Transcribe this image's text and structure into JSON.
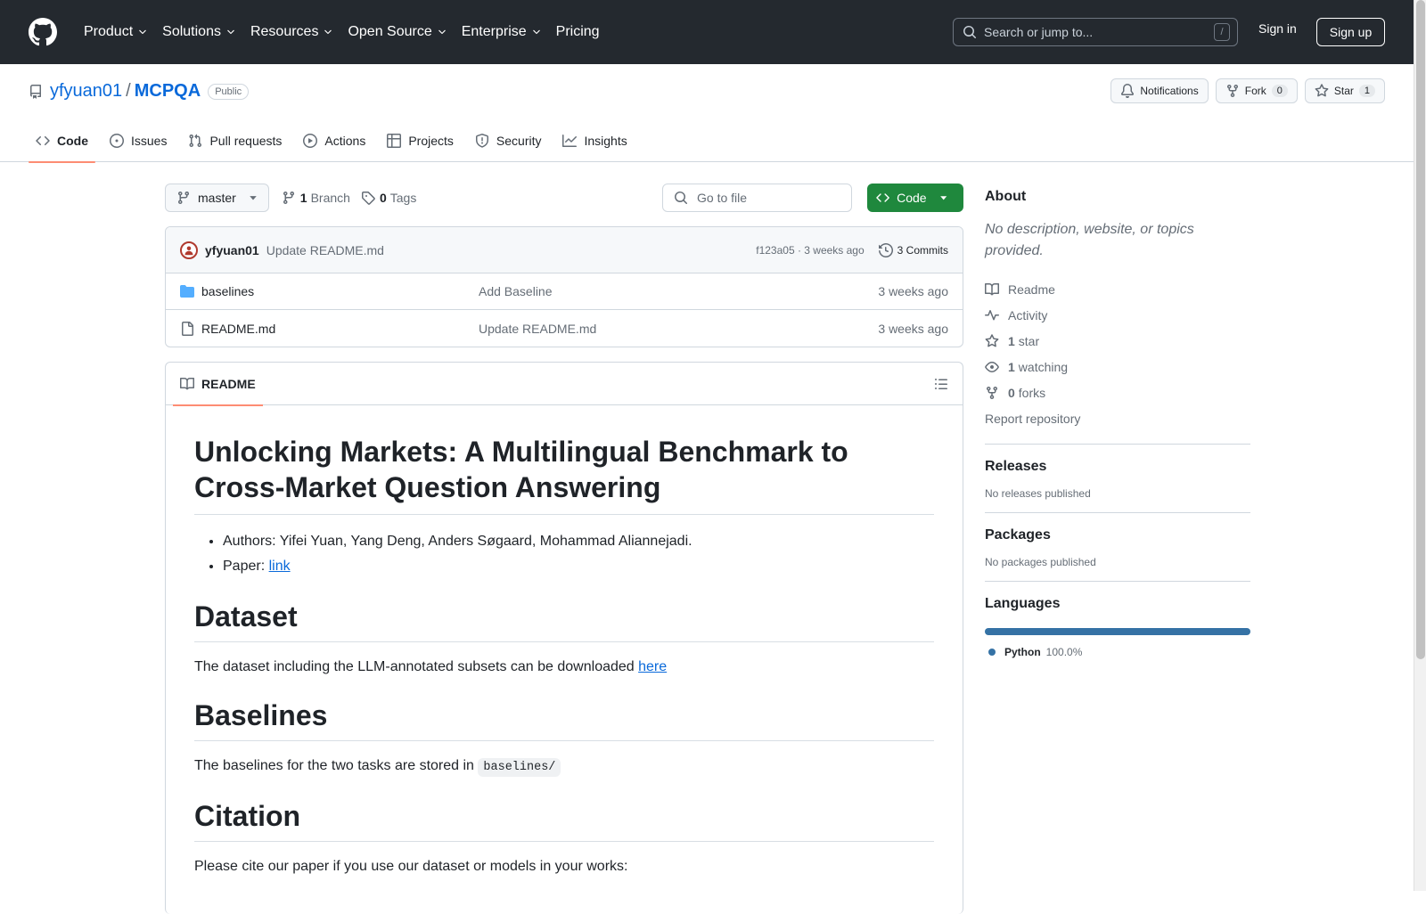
{
  "header": {
    "nav": [
      "Product",
      "Solutions",
      "Resources",
      "Open Source",
      "Enterprise",
      "Pricing"
    ],
    "search_placeholder": "Search or jump to...",
    "search_shortcut": "/",
    "sign_in": "Sign in",
    "sign_up": "Sign up"
  },
  "repo": {
    "owner": "yfyuan01",
    "separator": "/",
    "name": "MCPQA",
    "visibility": "Public",
    "notifications": "Notifications",
    "fork_label": "Fork",
    "fork_count": "0",
    "star_label": "Star",
    "star_count": "1",
    "tabs": [
      "Code",
      "Issues",
      "Pull requests",
      "Actions",
      "Projects",
      "Security",
      "Insights"
    ]
  },
  "filebar": {
    "branch": "master",
    "branch_count": "1",
    "branch_label": "Branch",
    "tag_count": "0",
    "tag_label": "Tags",
    "goto_placeholder": "Go to file",
    "code_button": "Code"
  },
  "commit": {
    "user": "yfyuan01",
    "message": "Update README.md",
    "hash_time": "f123a05 · 3 weeks ago",
    "commits": "3 Commits"
  },
  "files": [
    {
      "name": "baselines",
      "type": "folder",
      "message": "Add Baseline",
      "time": "3 weeks ago"
    },
    {
      "name": "README.md",
      "type": "file",
      "message": "Update README.md",
      "time": "3 weeks ago"
    }
  ],
  "readme": {
    "tab": "README",
    "title": "Unlocking Markets: A Multilingual Benchmark to Cross-Market Question Answering",
    "authors": "Authors: Yifei Yuan, Yang Deng, Anders Søgaard, Mohammad Aliannejadi.",
    "paper_prefix": "Paper: ",
    "paper_link": "link",
    "dataset_heading": "Dataset",
    "dataset_text": "The dataset including the LLM-annotated subsets can be downloaded ",
    "dataset_link": "here",
    "baselines_heading": "Baselines",
    "baselines_text": "The baselines for the two tasks are stored in ",
    "baselines_code": "baselines/",
    "citation_heading": "Citation",
    "citation_text": "Please cite our paper if you use our dataset or models in your works:"
  },
  "sidebar": {
    "about_heading": "About",
    "description": "No description, website, or topics provided.",
    "readme": "Readme",
    "activity": "Activity",
    "stars_count": "1",
    "stars_label": "star",
    "watching_count": "1",
    "watching_label": "watching",
    "forks_count": "0",
    "forks_label": "forks",
    "report": "Report repository",
    "releases_heading": "Releases",
    "releases_text": "No releases published",
    "packages_heading": "Packages",
    "packages_text": "No packages published",
    "languages_heading": "Languages",
    "language_name": "Python",
    "language_percent": "100.0%"
  },
  "colors": {
    "header_bg": "#24292f",
    "link": "#0969da",
    "code_button": "#1f883d",
    "tab_underline": "#fd8c73",
    "python": "#3572A5"
  }
}
